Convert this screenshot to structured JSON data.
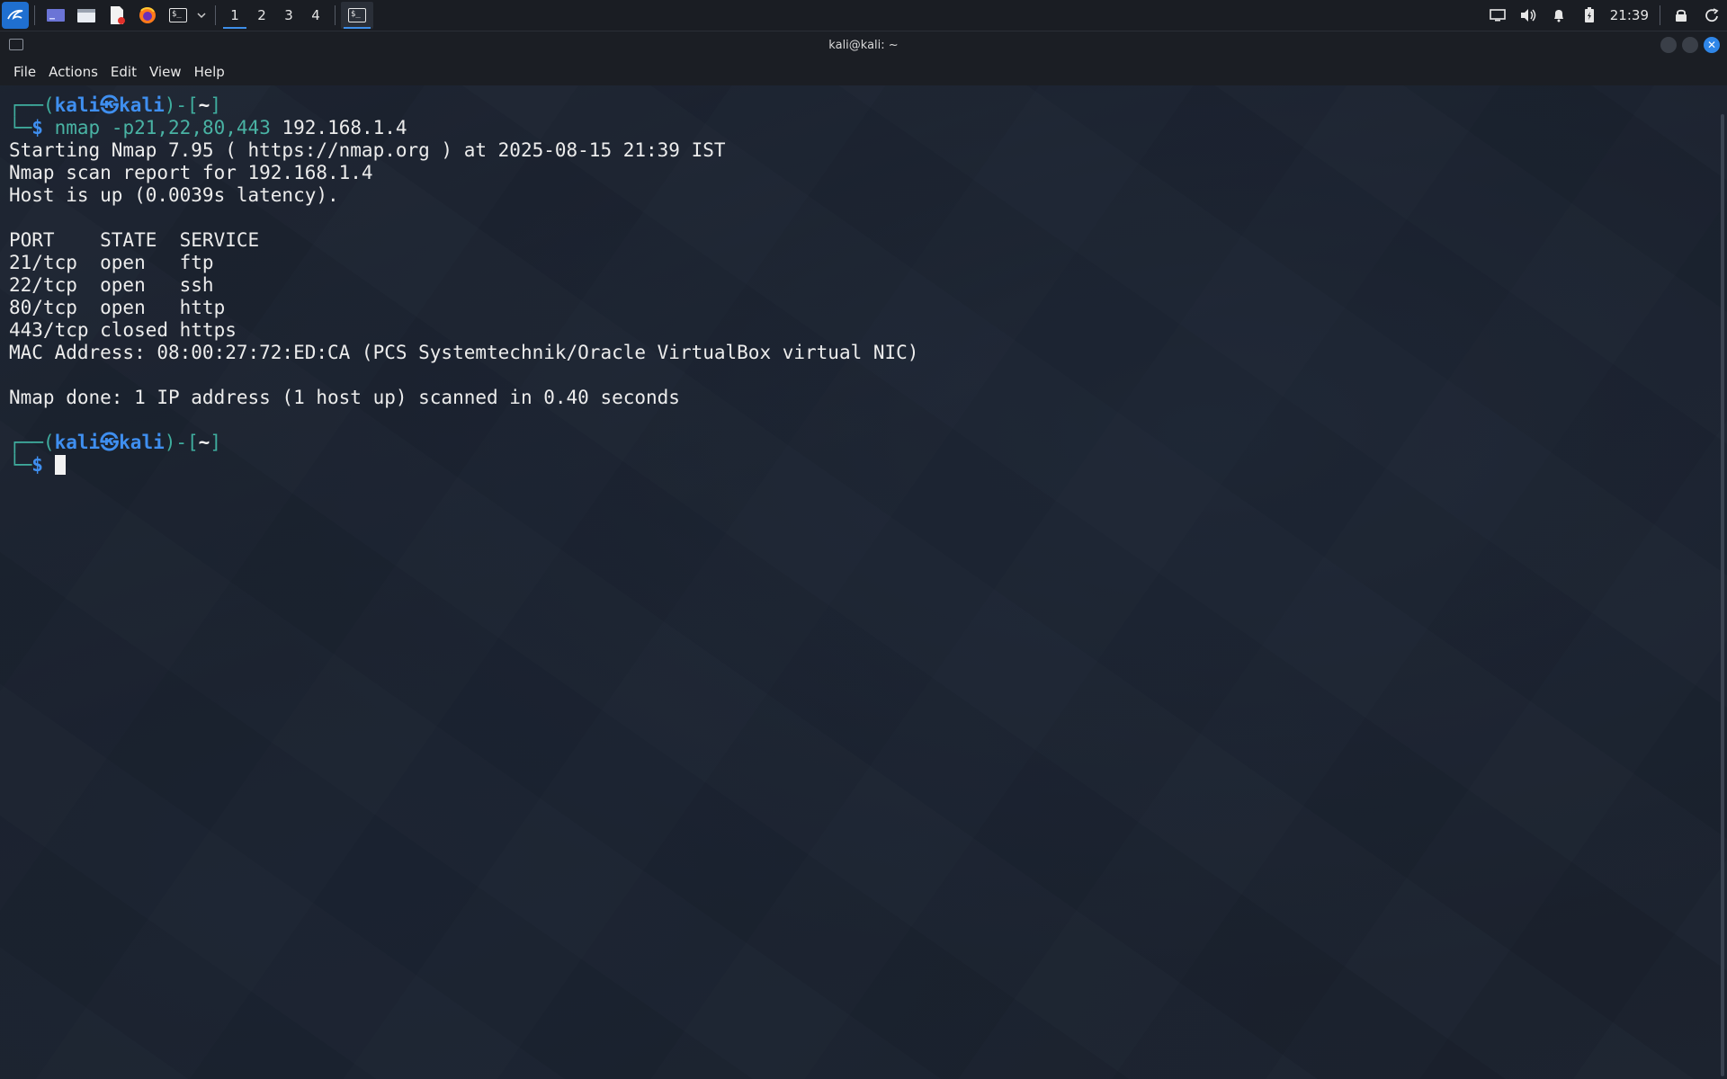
{
  "panel": {
    "workspaces": [
      "1",
      "2",
      "3",
      "4"
    ],
    "active_workspace": "1",
    "clock": "21:39",
    "launchers": [
      "kali-menu-icon",
      "desktop-icon",
      "file-manager-icon",
      "text-editor-icon",
      "firefox-icon",
      "terminal-icon",
      "chevron-down-icon"
    ],
    "tray_icons": [
      "display-icon",
      "volume-icon",
      "bell-icon",
      "battery-icon",
      "lock-icon",
      "power-icon"
    ]
  },
  "window": {
    "title": "kali@kali: ~",
    "menu": [
      "File",
      "Actions",
      "Edit",
      "View",
      "Help"
    ]
  },
  "terminal": {
    "prompt1": {
      "user": "kali",
      "host": "kali",
      "dir": "~",
      "command_name": "nmap",
      "command_args": "-p21,22,80,443",
      "command_target": "192.168.1.4"
    },
    "output": [
      "Starting Nmap 7.95 ( https://nmap.org ) at 2025-08-15 21:39 IST",
      "Nmap scan report for 192.168.1.4",
      "Host is up (0.0039s latency).",
      "",
      "PORT    STATE  SERVICE",
      "21/tcp  open   ftp",
      "22/tcp  open   ssh",
      "80/tcp  open   http",
      "443/tcp closed https",
      "MAC Address: 08:00:27:72:ED:CA (PCS Systemtechnik/Oracle VirtualBox virtual NIC)",
      "",
      "Nmap done: 1 IP address (1 host up) scanned in 0.40 seconds",
      ""
    ],
    "prompt2": {
      "user": "kali",
      "host": "kali",
      "dir": "~"
    }
  }
}
